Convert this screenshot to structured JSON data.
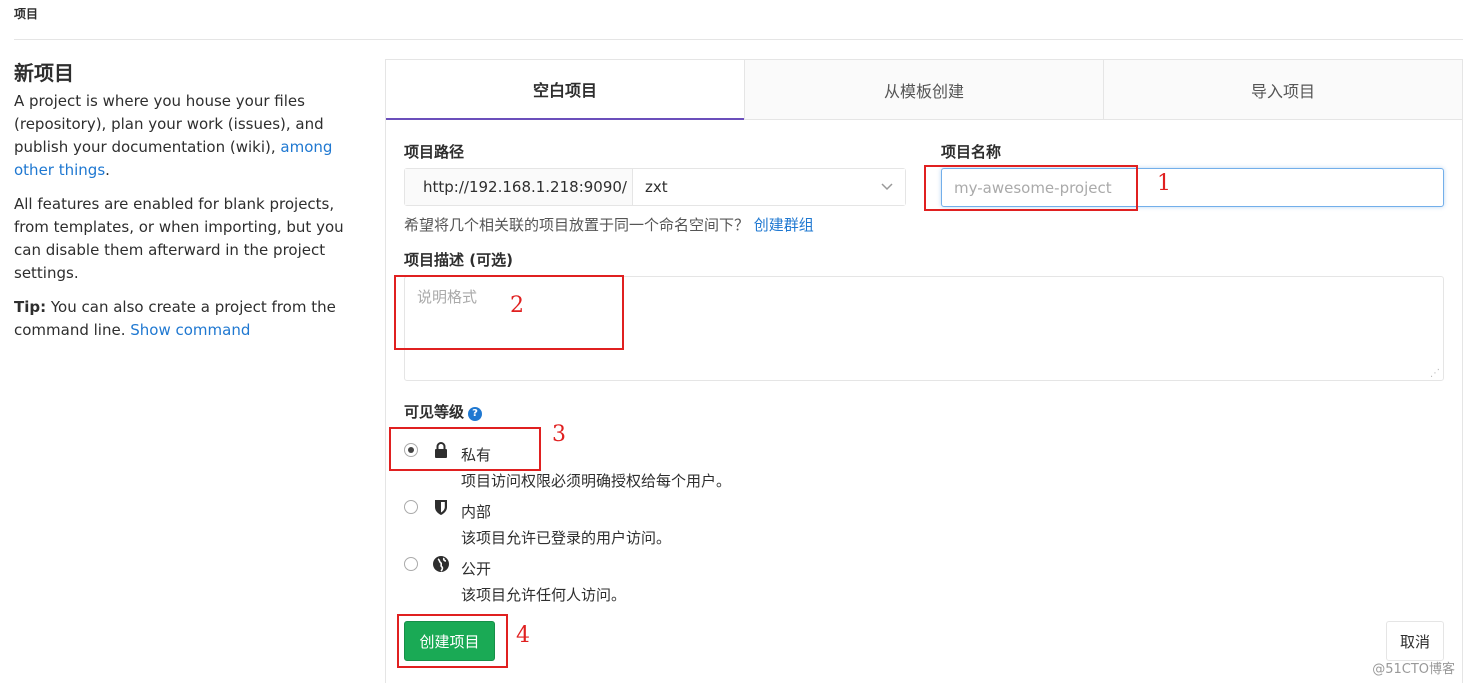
{
  "breadcrumb": "项目",
  "info": {
    "title": "新项目",
    "p1_text": "A project is where you house your files (repository), plan your work (issues), and publish your documentation (wiki),",
    "p1_link": "among other things",
    "p1_end": ".",
    "p2_text": "All features are enabled for blank projects, from templates, or when importing, but you can disable them afterward in the project settings.",
    "p3_bold": "Tip:",
    "p3_text": "You can also create a project from the command line.",
    "p3_link": "Show command"
  },
  "tabs": [
    {
      "label": "空白项目",
      "active": true
    },
    {
      "label": "从模板创建",
      "active": false
    },
    {
      "label": "导入项目",
      "active": false
    }
  ],
  "form": {
    "path_label": "项目路径",
    "path_prefix": "http://192.168.1.218:9090/",
    "namespace": "zxt",
    "name_label": "项目名称",
    "name_placeholder": "my-awesome-project",
    "hint_text": "希望将几个相关联的项目放置于同一个命名空间下？",
    "hint_link": "创建群组",
    "desc_label": "项目描述 (可选)",
    "desc_placeholder": "说明格式",
    "visibility_label": "可见等级",
    "visibility_help_icon": "question-circle-icon",
    "visibility_options": [
      {
        "label": "私有",
        "desc": "项目访问权限必须明确授权给每个用户。",
        "icon": "lock-icon",
        "checked": true
      },
      {
        "label": "内部",
        "desc": "该项目允许已登录的用户访问。",
        "icon": "shield-icon",
        "checked": false
      },
      {
        "label": "公开",
        "desc": "该项目允许任何人访问。",
        "icon": "globe-icon",
        "checked": false
      }
    ],
    "create_button": "创建项目",
    "cancel_button": "取消"
  },
  "annotations": [
    "1",
    "2",
    "3",
    "4"
  ],
  "watermark": "@51CTO博客",
  "colors": {
    "accent_link": "#1f78d1",
    "tab_active_border": "#6b4fbb",
    "create_button": "#1aaa55",
    "annotation": "#e02020"
  }
}
